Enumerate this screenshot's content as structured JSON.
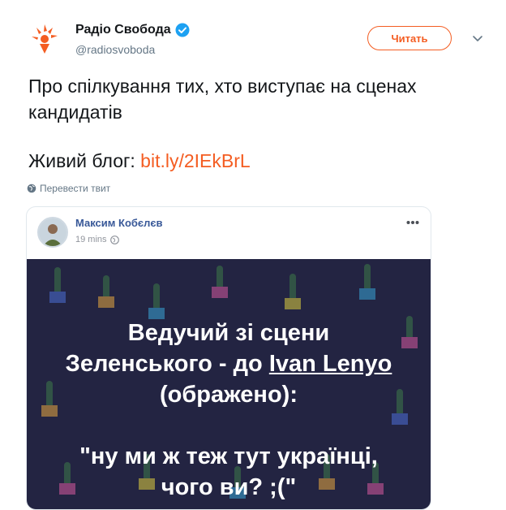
{
  "account": {
    "display_name": "Радіо Свобода",
    "handle": "@radiosvoboda",
    "verified": true,
    "follow_label": "Читать"
  },
  "tweet": {
    "text_line1": "Про спілкування тих, хто виступає на сценах кандидатів",
    "blog_prefix": "Живий блог: ",
    "blog_link": "bit.ly/2IEkBrL",
    "translate_label": "Перевести твит"
  },
  "embedded_post": {
    "author": "Максим Кобєлєв",
    "time": "19 mins",
    "image_text": {
      "line1": "Ведучий зі сцени",
      "line2_prefix": "Зеленського - до ",
      "line2_name": "Ivan Lenyo",
      "line3": "(ображено):",
      "line4": "\"ну ми ж теж тут українці,",
      "line5": "чого ви? ;(\""
    }
  },
  "colors": {
    "brand_orange": "#f45d22",
    "verified_blue": "#1da1f2",
    "fb_author_blue": "#385898",
    "image_bg": "#232442"
  },
  "icons": [
    "radio-svoboda-logo-icon",
    "verified-badge-icon",
    "chevron-down-icon",
    "globe-icon",
    "more-dots-icon"
  ]
}
